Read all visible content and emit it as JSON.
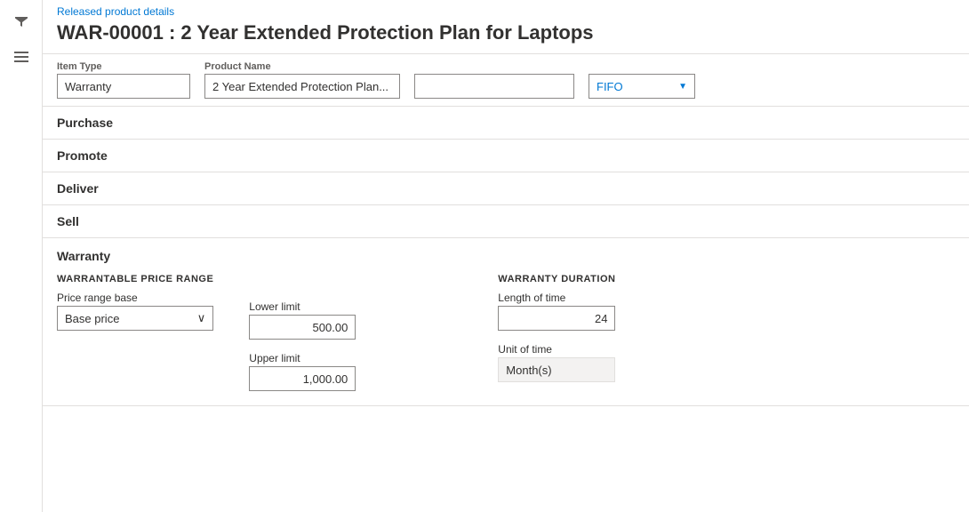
{
  "sidebar": {
    "filter_icon": "▼",
    "menu_icon": "≡"
  },
  "breadcrumb": {
    "text": "Released product details"
  },
  "page_title": "WAR-00001 : 2 Year Extended Protection Plan for Laptops",
  "top_fields": {
    "item_type_label": "Item type",
    "item_type_value": "Warranty",
    "product_name_label": "Product name",
    "product_name_value": "2 Year Extended Protection Plan...",
    "cost_method_label": "",
    "cost_method_value": "FIFO",
    "cost_method_dropdown": true
  },
  "sections": [
    {
      "id": "purchase",
      "label": "Purchase"
    },
    {
      "id": "promote",
      "label": "Promote"
    },
    {
      "id": "deliver",
      "label": "Deliver"
    },
    {
      "id": "sell",
      "label": "Sell"
    }
  ],
  "warranty_section": {
    "title": "Warranty",
    "warrantable_price_range": {
      "block_title": "WARRANTABLE PRICE RANGE",
      "price_range_base_label": "Price range base",
      "price_range_base_value": "Base price",
      "lower_limit_label": "Lower limit",
      "lower_limit_value": "500.00",
      "upper_limit_label": "Upper limit",
      "upper_limit_value": "1,000.00"
    },
    "warranty_duration": {
      "block_title": "WARRANTY DURATION",
      "length_of_time_label": "Length of time",
      "length_of_time_value": "24",
      "unit_of_time_label": "Unit of time",
      "unit_of_time_value": "Month(s)"
    }
  }
}
